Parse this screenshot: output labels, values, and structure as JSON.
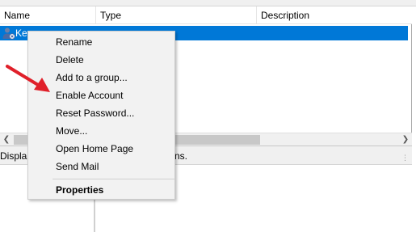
{
  "columns": {
    "name": "Name",
    "type": "Type",
    "description": "Description"
  },
  "row": {
    "name": "Ke",
    "icon": "user-icon"
  },
  "status": {
    "left": "Displa",
    "right": "ns."
  },
  "context_menu": {
    "items": [
      "Rename",
      "Delete",
      "Add to a group...",
      "Enable Account",
      "Reset Password...",
      "Move...",
      "Open Home Page",
      "Send Mail"
    ],
    "properties": "Properties"
  },
  "colors": {
    "selection": "#0078d7",
    "arrow": "#e0202a"
  }
}
